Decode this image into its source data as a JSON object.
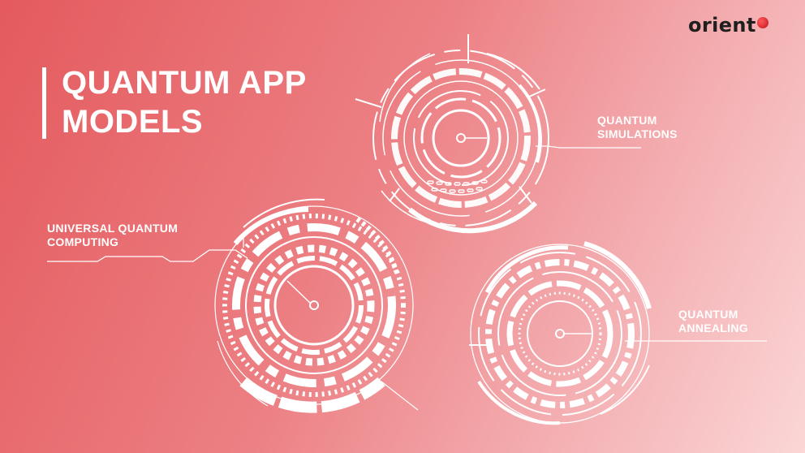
{
  "title": {
    "line1": "QUANTUM APP",
    "line2": "MODELS"
  },
  "logo": {
    "text": "orient",
    "dot_color": "#d0161c"
  },
  "labels": {
    "simulations": {
      "line1": "QUANTUM",
      "line2": "SIMULATIONS"
    },
    "universal": {
      "line1": "UNIVERSAL QUANTUM",
      "line2": "COMPUTING"
    },
    "annealing": {
      "line1": "QUANTUM",
      "line2": "ANNEALING"
    }
  },
  "colors": {
    "bg_start": "#e45a5d",
    "bg_end": "#fbd6d6",
    "foreground": "#ffffff"
  }
}
